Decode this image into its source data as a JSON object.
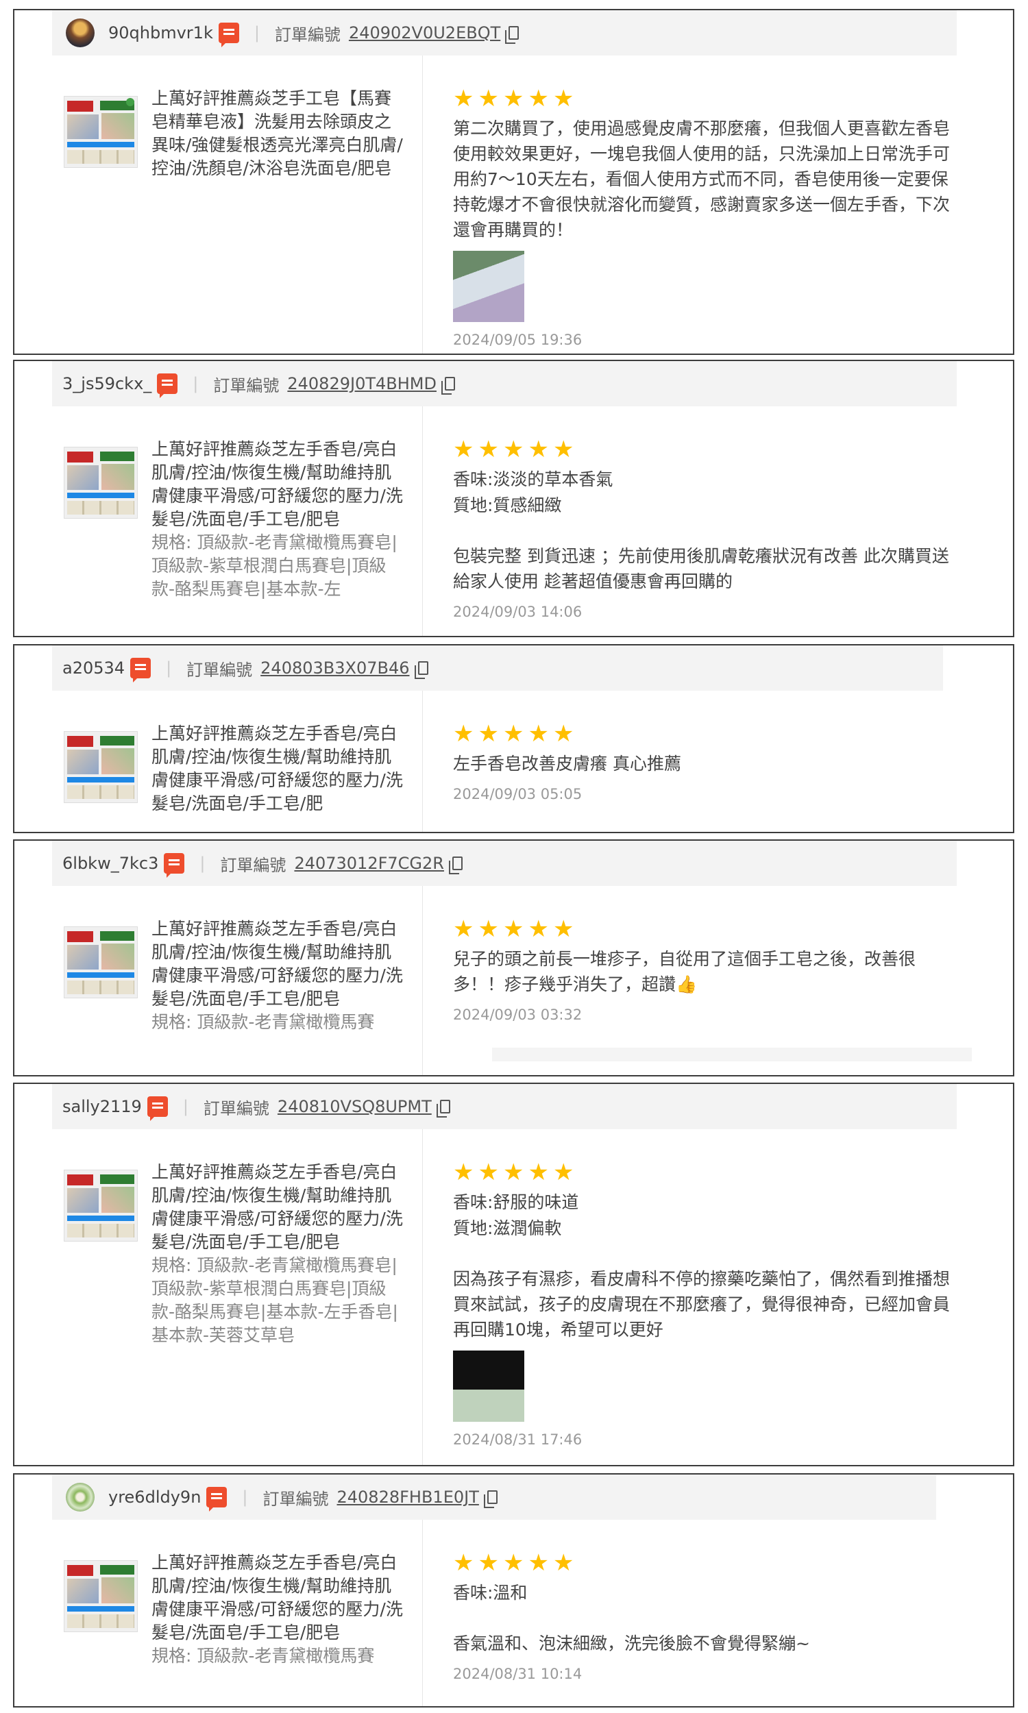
{
  "order_label": "訂單編號",
  "reviews": [
    {
      "username": "90qhbmvr1k",
      "order_no": "240902V0U2EBQT",
      "product": "上萬好評推薦焱芝手工皂【馬賽皂精華皂液】洗髮用去除頭皮之異味/強健髮根透亮光澤亮白肌膚/控油/洗顏皂/沐浴皂洗面皂/肥皂",
      "spec": "",
      "stars": 5,
      "attrs": [],
      "text": "第二次購買了，使用過感覺皮膚不那麼癢，但我個人更喜歡左香皂使用較效果更好，一塊皂我個人使用的話，只洗澡加上日常洗手可用約7～10天左右，看個人使用方式而不同，香皂使用後一定要保持乾爆才不會很快就溶化而變質，感謝賣家多送一個左手香，下次還會再購買的！",
      "timestamp": "2024/09/05 19:36"
    },
    {
      "username": "3_js59ckx_",
      "order_no": "240829J0T4BHMD",
      "product": "上萬好評推薦焱芝左手香皂/亮白肌膚/控油/恢復生機/幫助維持肌膚健康平滑感/可舒緩您的壓力/洗髮皂/洗面皂/手工皂/肥皂",
      "spec": "規格: 頂級款-老青黛橄欖馬賽皂|頂級款-紫草根潤白馬賽皂|頂級款-酪梨馬賽皂|基本款-左",
      "stars": 5,
      "attrs": [
        "香味:淡淡的草本香氣",
        "質地:質感細緻"
      ],
      "text": "包裝完整 到貨迅速 ；先前使用後肌膚乾癢狀況有改善 此次購買送給家人使用 趁著超值優惠會再回購的",
      "timestamp": "2024/09/03 14:06"
    },
    {
      "username": "a20534",
      "order_no": "240803B3X07B46",
      "product": "上萬好評推薦焱芝左手香皂/亮白肌膚/控油/恢復生機/幫助維持肌膚健康平滑感/可舒緩您的壓力/洗髮皂/洗面皂/手工皂/肥",
      "spec": "",
      "stars": 5,
      "attrs": [],
      "text": "左手香皂改善皮膚癢 真心推薦",
      "timestamp": "2024/09/03 05:05"
    },
    {
      "username": "6lbkw_7kc3",
      "order_no": "24073012F7CG2R",
      "product": "上萬好評推薦焱芝左手香皂/亮白肌膚/控油/恢復生機/幫助維持肌膚健康平滑感/可舒緩您的壓力/洗髮皂/洗面皂/手工皂/肥皂",
      "spec": "規格: 頂級款-老青黛橄欖馬賽",
      "stars": 5,
      "attrs": [],
      "text": "兒子的頭之前長一堆疹子，自從用了這個手工皂之後，改善很多！！疹子幾乎消失了，超讚👍",
      "timestamp": "2024/09/03 03:32"
    },
    {
      "username": "sally2119",
      "order_no": "240810VSQ8UPMT",
      "product": "上萬好評推薦焱芝左手香皂/亮白肌膚/控油/恢復生機/幫助維持肌膚健康平滑感/可舒緩您的壓力/洗髮皂/洗面皂/手工皂/肥皂",
      "spec": "規格: 頂級款-老青黛橄欖馬賽皂|頂級款-紫草根潤白馬賽皂|頂級款-酪梨馬賽皂|基本款-左手香皂|基本款-芙蓉艾草皂",
      "stars": 5,
      "attrs": [
        "香味:舒服的味道",
        "質地:滋潤偏軟"
      ],
      "text": "因為孩子有濕疹，看皮膚科不停的擦藥吃藥怕了，偶然看到推播想買來試試，孩子的皮膚現在不那麼癢了，覺得很神奇，已經加會員再回購10塊，希望可以更好",
      "timestamp": "2024/08/31 17:46"
    },
    {
      "username": "yre6dldy9n",
      "order_no": "240828FHB1E0JT",
      "product": "上萬好評推薦焱芝左手香皂/亮白肌膚/控油/恢復生機/幫助維持肌膚健康平滑感/可舒緩您的壓力/洗髮皂/洗面皂/手工皂/肥皂",
      "spec": "規格: 頂級款-老青黛橄欖馬賽",
      "stars": 5,
      "attrs": [
        "香味:溫和"
      ],
      "text": "香氣溫和、泡沫細緻，洗完後臉不會覺得緊繃~",
      "timestamp": "2024/08/31 10:14"
    }
  ]
}
